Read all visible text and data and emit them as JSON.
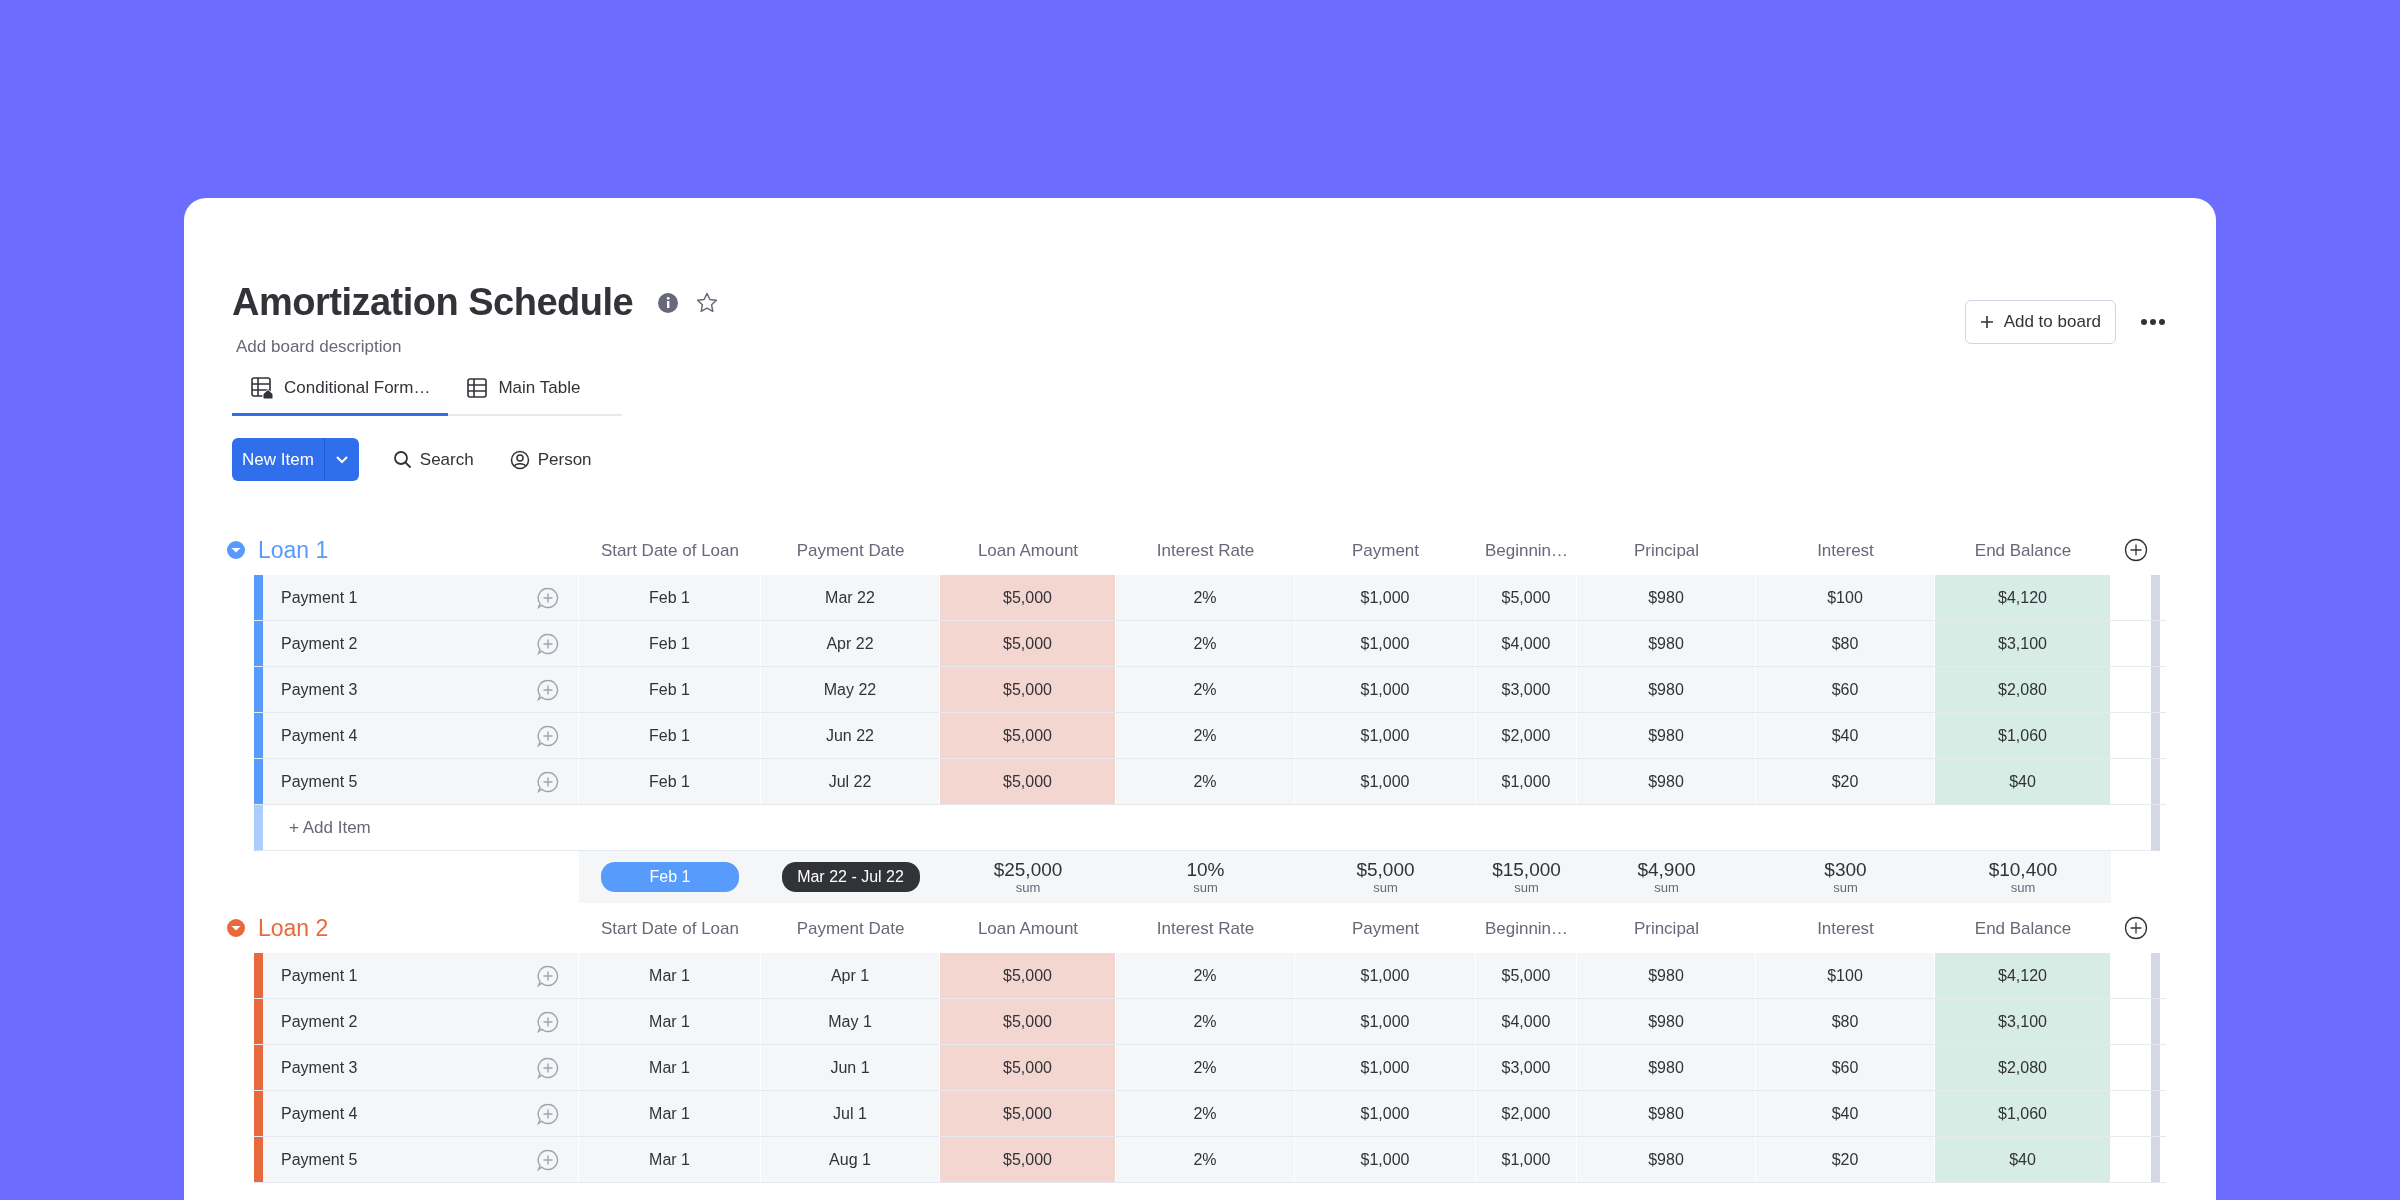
{
  "board": {
    "title": "Amortization Schedule",
    "description": "Add board description",
    "add_to_board": "Add to board"
  },
  "tabs": [
    {
      "label": "Conditional Form…",
      "selected": true
    },
    {
      "label": "Main Table",
      "selected": false
    }
  ],
  "toolbar": {
    "new_item": "New Item",
    "search": "Search",
    "person": "Person"
  },
  "groups": [
    {
      "name": "Loan 1",
      "color": "#579bfc",
      "columns": [
        {
          "label": "Start Date of Loan"
        },
        {
          "label": "Payment Date"
        },
        {
          "label": "Loan Amount",
          "color": "#f4d6d1"
        },
        {
          "label": "Interest Rate"
        },
        {
          "label": "Payment"
        },
        {
          "label": "Beginnin…"
        },
        {
          "label": "Principal"
        },
        {
          "label": "Interest"
        },
        {
          "label": "End Balance",
          "color": "#d6ece5"
        }
      ],
      "rows": [
        {
          "name": "Payment 1",
          "cells": [
            "Feb 1",
            "Mar 22",
            "$5,000",
            "2%",
            "$1,000",
            "$5,000",
            "$980",
            "$100",
            "$4,120"
          ]
        },
        {
          "name": "Payment 2",
          "cells": [
            "Feb 1",
            "Apr 22",
            "$5,000",
            "2%",
            "$1,000",
            "$4,000",
            "$980",
            "$80",
            "$3,100"
          ]
        },
        {
          "name": "Payment 3",
          "cells": [
            "Feb 1",
            "May 22",
            "$5,000",
            "2%",
            "$1,000",
            "$3,000",
            "$980",
            "$60",
            "$2,080"
          ]
        },
        {
          "name": "Payment 4",
          "cells": [
            "Feb 1",
            "Jun 22",
            "$5,000",
            "2%",
            "$1,000",
            "$2,000",
            "$980",
            "$40",
            "$1,060"
          ]
        },
        {
          "name": "Payment 5",
          "cells": [
            "Feb 1",
            "Jul 22",
            "$5,000",
            "2%",
            "$1,000",
            "$1,000",
            "$980",
            "$20",
            "$40"
          ]
        }
      ],
      "add_item": "+ Add Item",
      "summary": [
        {
          "kind": "pill",
          "text": "Feb 1",
          "color": "#579bfc"
        },
        {
          "kind": "pill",
          "text": "Mar 22 - Jul 22",
          "color": "#323338"
        },
        {
          "kind": "sum",
          "value": "$25,000",
          "label": "sum"
        },
        {
          "kind": "sum",
          "value": "10%",
          "label": "sum"
        },
        {
          "kind": "sum",
          "value": "$5,000",
          "label": "sum"
        },
        {
          "kind": "sum",
          "value": "$15,000",
          "label": "sum"
        },
        {
          "kind": "sum",
          "value": "$4,900",
          "label": "sum"
        },
        {
          "kind": "sum",
          "value": "$300",
          "label": "sum"
        },
        {
          "kind": "sum",
          "value": "$10,400",
          "label": "sum"
        }
      ]
    },
    {
      "name": "Loan 2",
      "color": "#e8693c",
      "columns": [
        {
          "label": "Start Date of Loan"
        },
        {
          "label": "Payment Date"
        },
        {
          "label": "Loan Amount",
          "color": "#f4d6d1"
        },
        {
          "label": "Interest Rate"
        },
        {
          "label": "Payment"
        },
        {
          "label": "Beginnin…"
        },
        {
          "label": "Principal"
        },
        {
          "label": "Interest"
        },
        {
          "label": "End Balance",
          "color": "#d6ece5"
        }
      ],
      "rows": [
        {
          "name": "Payment 1",
          "cells": [
            "Mar 1",
            "Apr 1",
            "$5,000",
            "2%",
            "$1,000",
            "$5,000",
            "$980",
            "$100",
            "$4,120"
          ]
        },
        {
          "name": "Payment 2",
          "cells": [
            "Mar 1",
            "May 1",
            "$5,000",
            "2%",
            "$1,000",
            "$4,000",
            "$980",
            "$80",
            "$3,100"
          ]
        },
        {
          "name": "Payment 3",
          "cells": [
            "Mar 1",
            "Jun 1",
            "$5,000",
            "2%",
            "$1,000",
            "$3,000",
            "$980",
            "$60",
            "$2,080"
          ]
        },
        {
          "name": "Payment 4",
          "cells": [
            "Mar 1",
            "Jul 1",
            "$5,000",
            "2%",
            "$1,000",
            "$2,000",
            "$980",
            "$40",
            "$1,060"
          ]
        },
        {
          "name": "Payment 5",
          "cells": [
            "Mar 1",
            "Aug 1",
            "$5,000",
            "2%",
            "$1,000",
            "$1,000",
            "$980",
            "$20",
            "$40"
          ]
        }
      ]
    }
  ]
}
